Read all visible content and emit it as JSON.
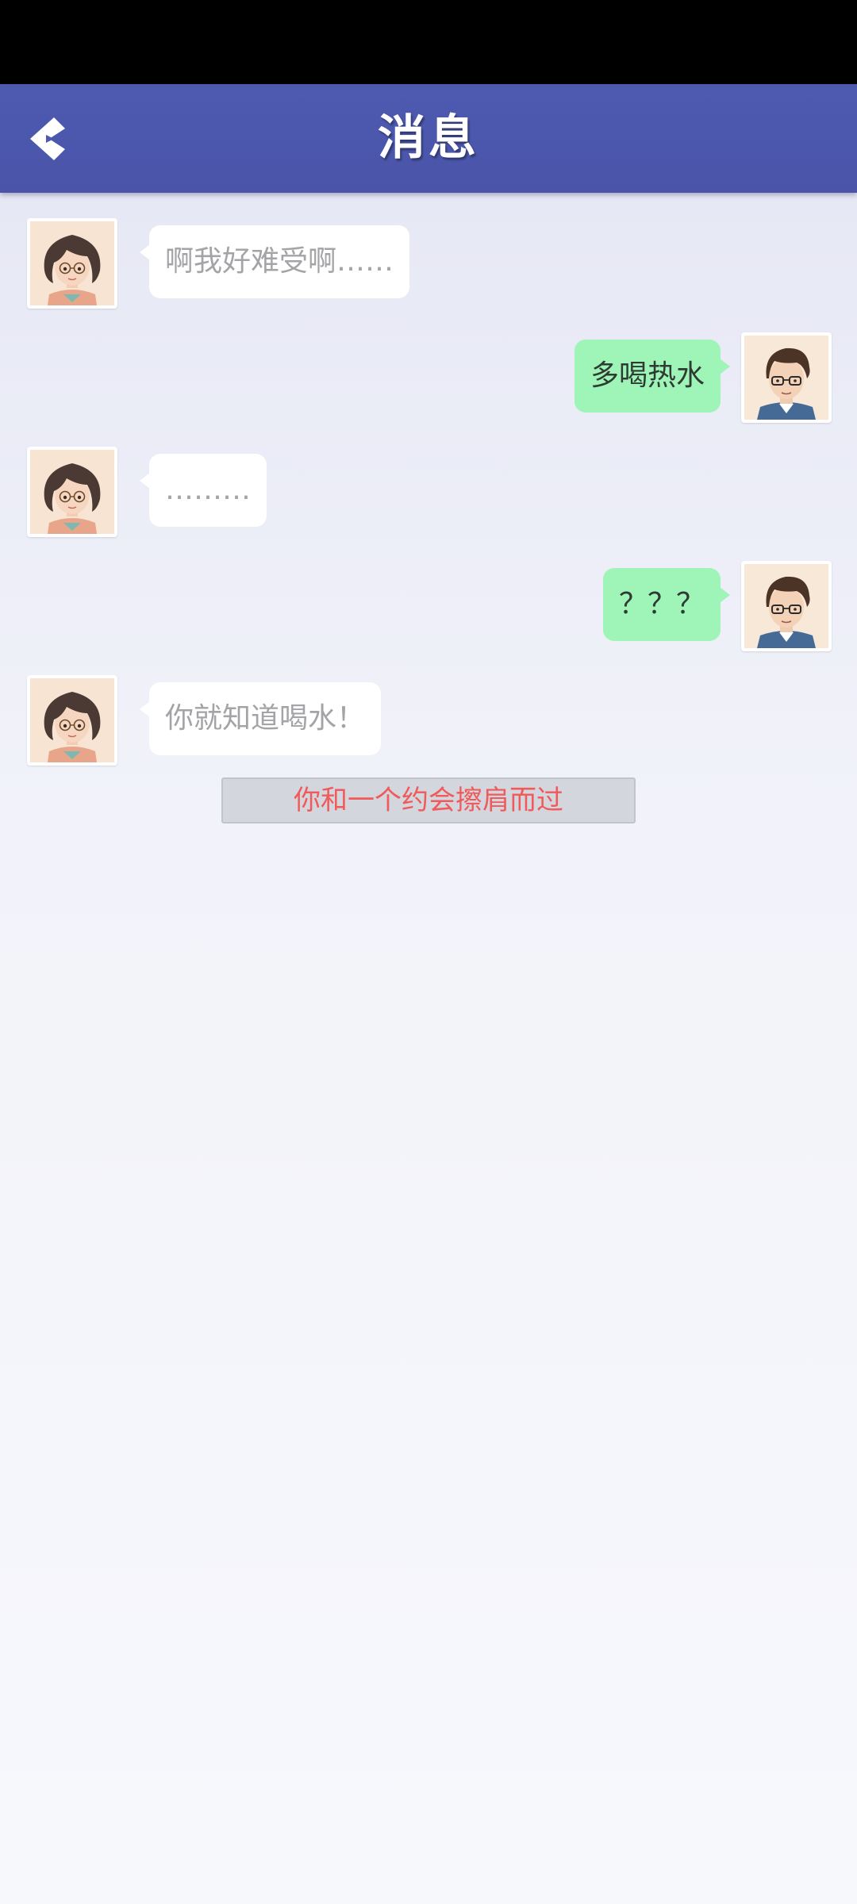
{
  "header": {
    "title": "消息",
    "back_icon": "chevron-left-icon"
  },
  "messages": [
    {
      "sender": "female",
      "side": "left",
      "text": "啊我好难受啊……"
    },
    {
      "sender": "male",
      "side": "right",
      "text": "多喝热水"
    },
    {
      "sender": "female",
      "side": "left",
      "text": "………"
    },
    {
      "sender": "male",
      "side": "right",
      "text": "？？？"
    },
    {
      "sender": "female",
      "side": "left",
      "text": "你就知道喝水！"
    }
  ],
  "system_notice": {
    "text": "你和一个约会擦肩而过"
  },
  "colors": {
    "header": "#4d5ab0",
    "sent_bubble": "#9ff5b8",
    "received_bubble": "#ffffff",
    "notice_text": "#f05a5a"
  }
}
